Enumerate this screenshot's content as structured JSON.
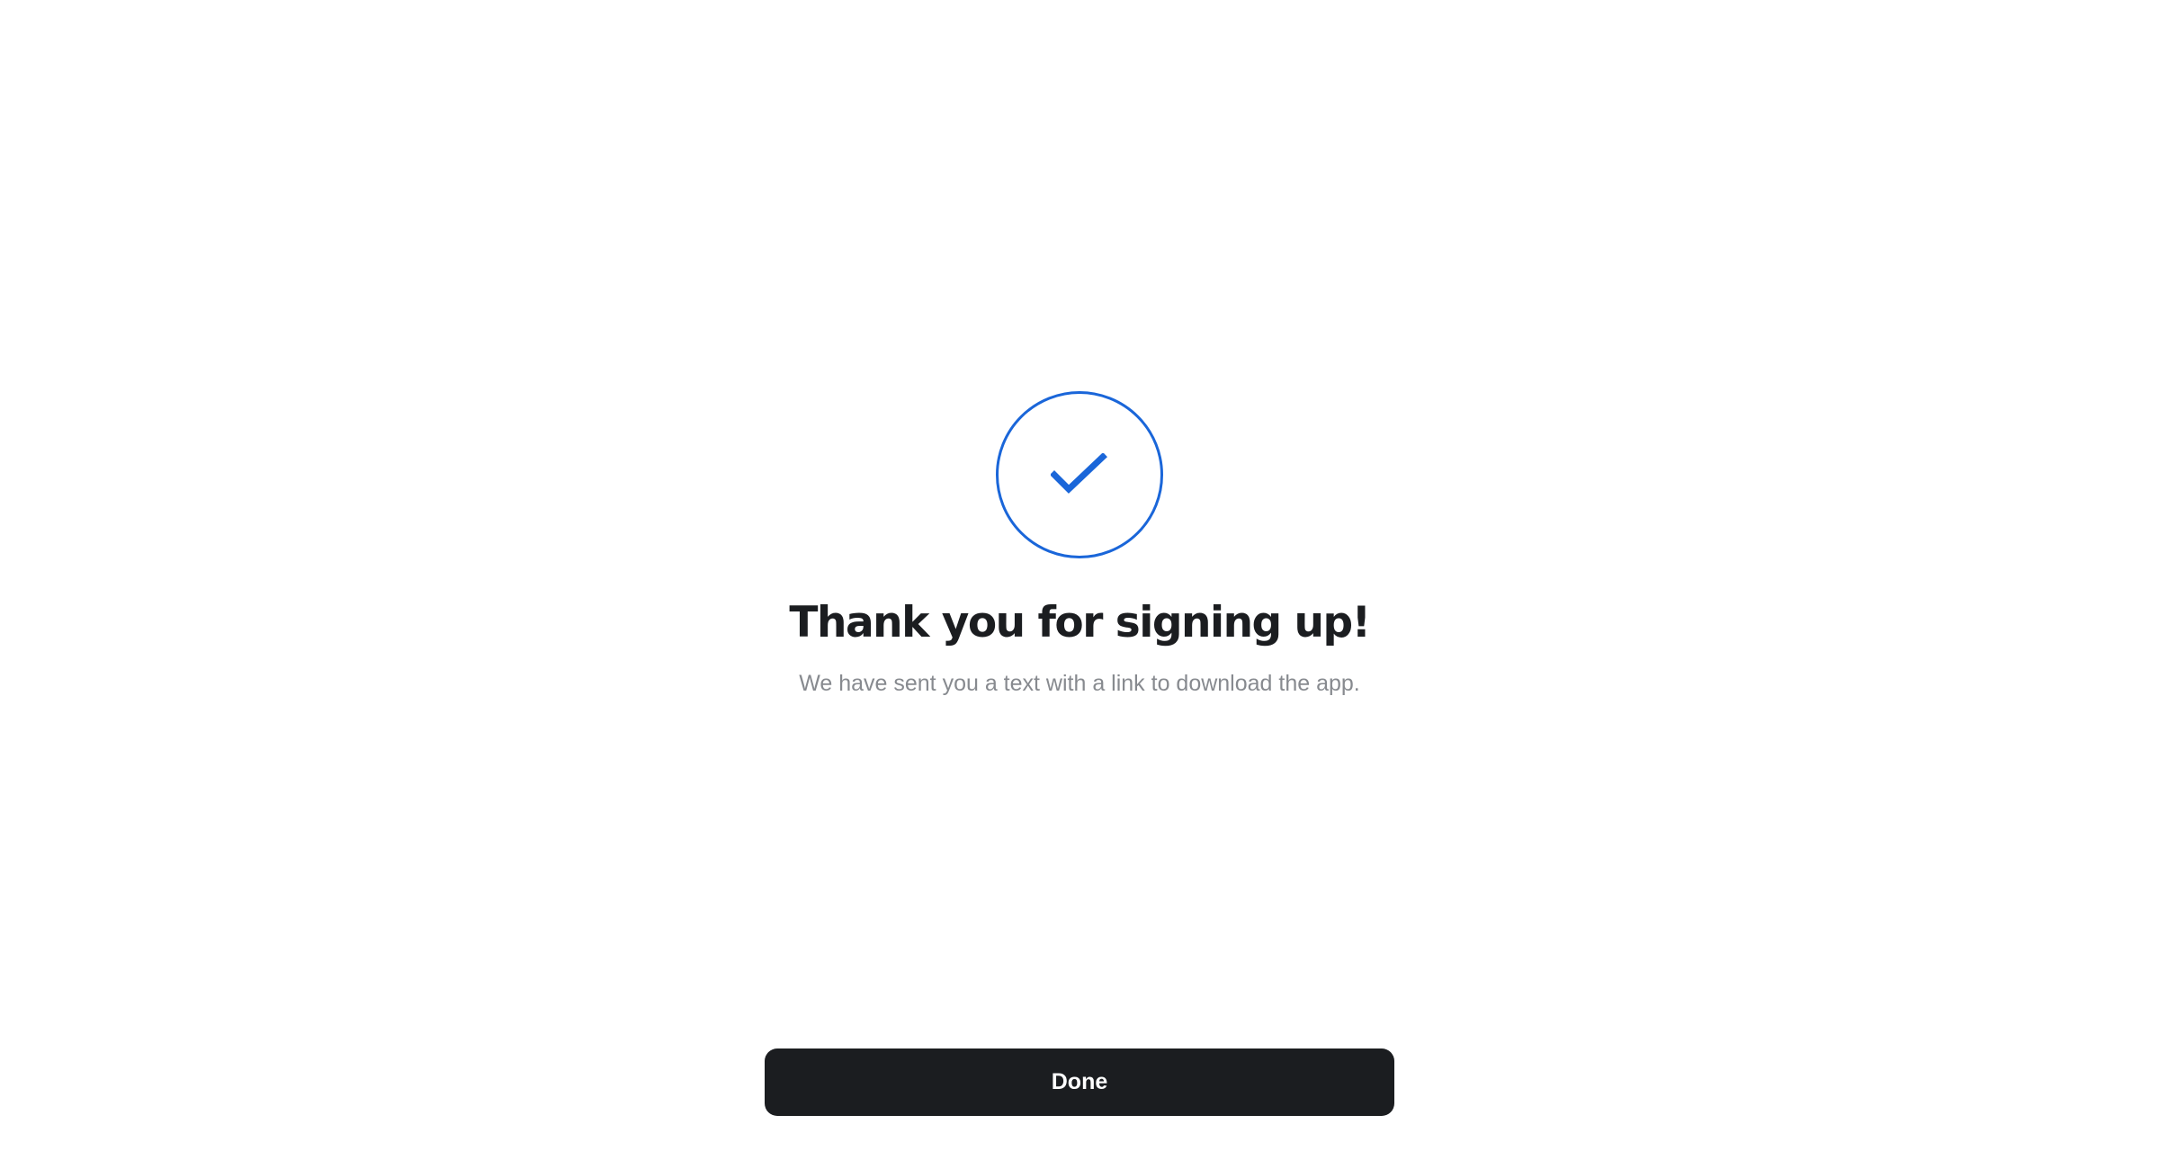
{
  "confirmation": {
    "icon": "checkmark-icon",
    "accent_color": "#1a66d9",
    "title": "Thank you for signing up!",
    "message": "We have sent you a text with a link to download the app."
  },
  "actions": {
    "done_label": "Done",
    "button_color": "#1b1d20"
  }
}
